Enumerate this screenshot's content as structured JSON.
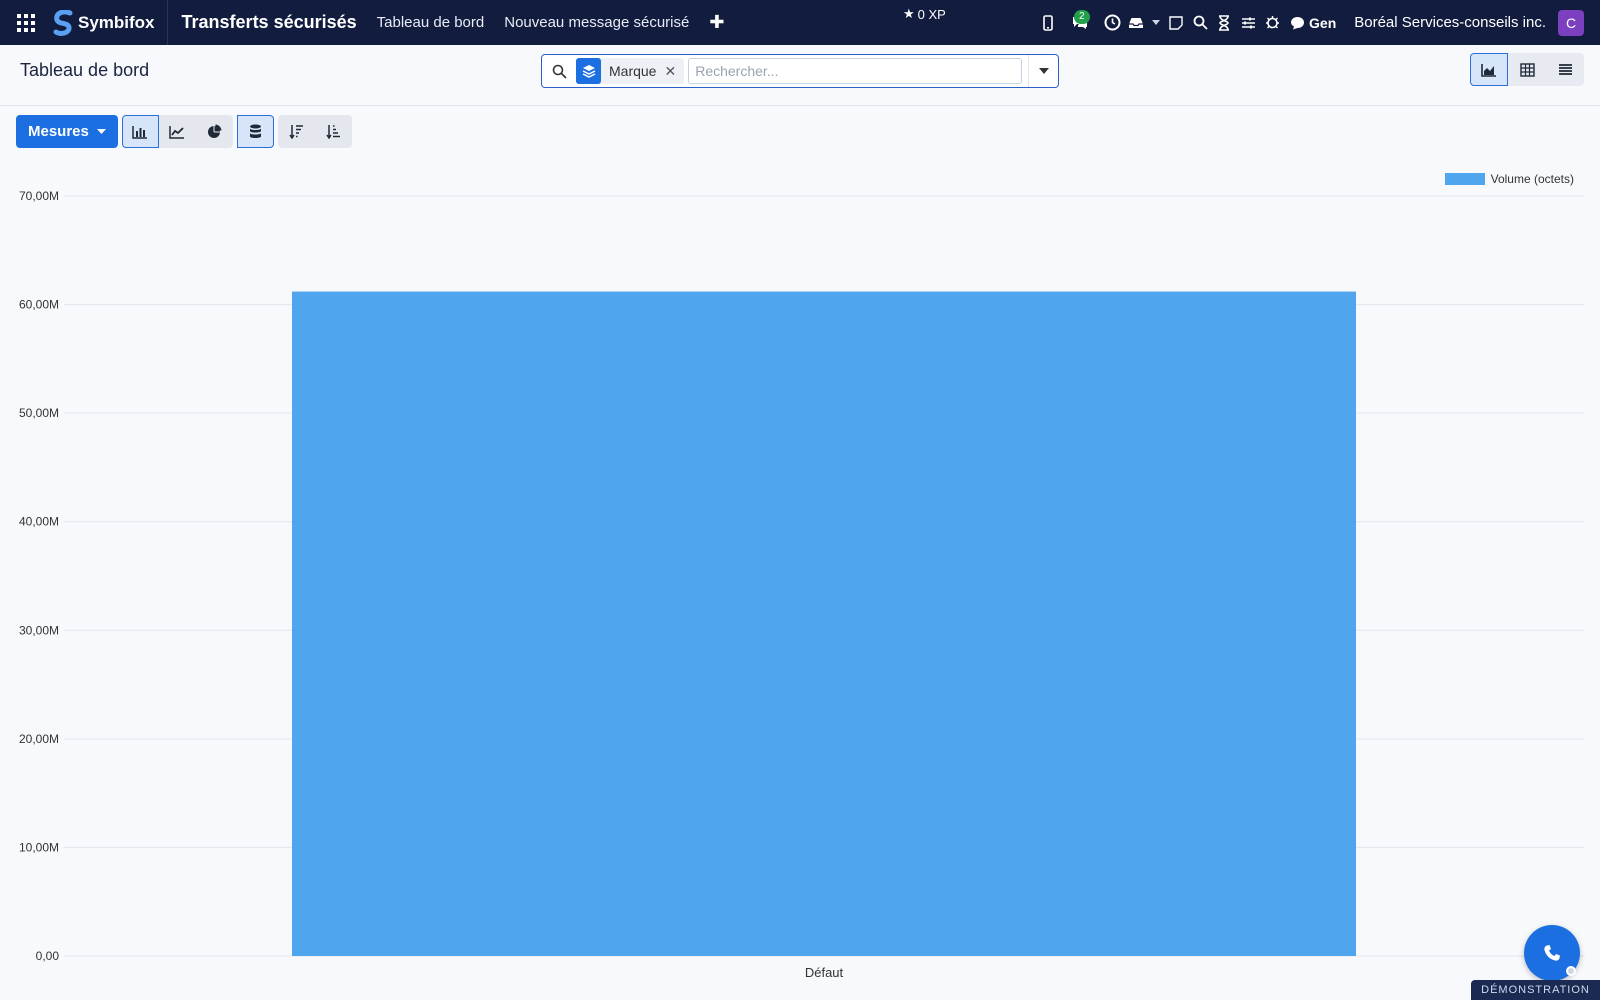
{
  "topnav": {
    "brand": "Symbifox",
    "module_title": "Transferts sécurisés",
    "links": [
      "Tableau de bord",
      "Nouveau message sécurisé"
    ],
    "xp": "0 XP",
    "chat_count": "2",
    "gen_label": "Gen",
    "company": "Boréal Services-conseils inc.",
    "avatar_initial": "C",
    "icons": [
      "apps-grid-icon",
      "mobile-icon",
      "chat-icon",
      "clock-icon",
      "inbox-icon",
      "caret-down-icon",
      "note-icon",
      "search-icon",
      "hourglass-icon",
      "sliders-icon",
      "bug-icon",
      "comment-icon"
    ]
  },
  "control_panel": {
    "title": "Tableau de bord",
    "facet_label": "Marque",
    "search_placeholder": "Rechercher...",
    "views": [
      "graph-view",
      "pivot-view",
      "list-view"
    ],
    "active_view": "graph-view"
  },
  "toolbar": {
    "measures_label": "Mesures",
    "chart_types": [
      "bar",
      "line",
      "pie"
    ],
    "active_chart_type": "bar",
    "stacked_active": true
  },
  "chart_data": {
    "type": "bar",
    "categories": [
      "Défaut"
    ],
    "series": [
      {
        "name": "Volume (octets)",
        "values": [
          61200000
        ],
        "color": "#4fa6ee"
      }
    ],
    "ylim": [
      0,
      70000000
    ],
    "yticks": [
      "0,00",
      "10,00M",
      "20,00M",
      "30,00M",
      "40,00M",
      "50,00M",
      "60,00M",
      "70,00M"
    ],
    "grid": true,
    "legend_position": "top-right",
    "title": "",
    "xlabel": "",
    "ylabel": ""
  },
  "footer": {
    "demo_label": "DÉMONSTRATION"
  },
  "colors": {
    "navbar": "#111c3e",
    "primary": "#1b6fe0",
    "bar": "#4fa6ee",
    "avatar": "#7b3fbf",
    "badge": "#22a04a"
  }
}
